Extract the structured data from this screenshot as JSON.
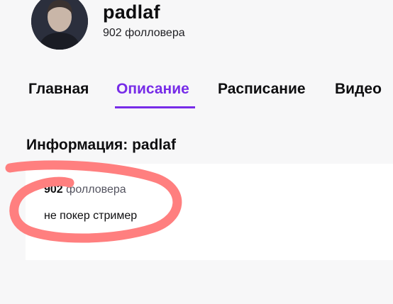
{
  "channel": {
    "name": "padlaf",
    "followers_text": "902 фолловера"
  },
  "tabs": [
    {
      "label": "Главная",
      "active": false
    },
    {
      "label": "Описание",
      "active": true
    },
    {
      "label": "Расписание",
      "active": false
    },
    {
      "label": "Видео",
      "active": false
    }
  ],
  "about": {
    "title": "Информация: padlaf",
    "followers_count": "902",
    "followers_label": "фолловера",
    "bio": "не покер стример"
  },
  "colors": {
    "accent": "#772ce8",
    "annotation": "#ff7f7f"
  }
}
